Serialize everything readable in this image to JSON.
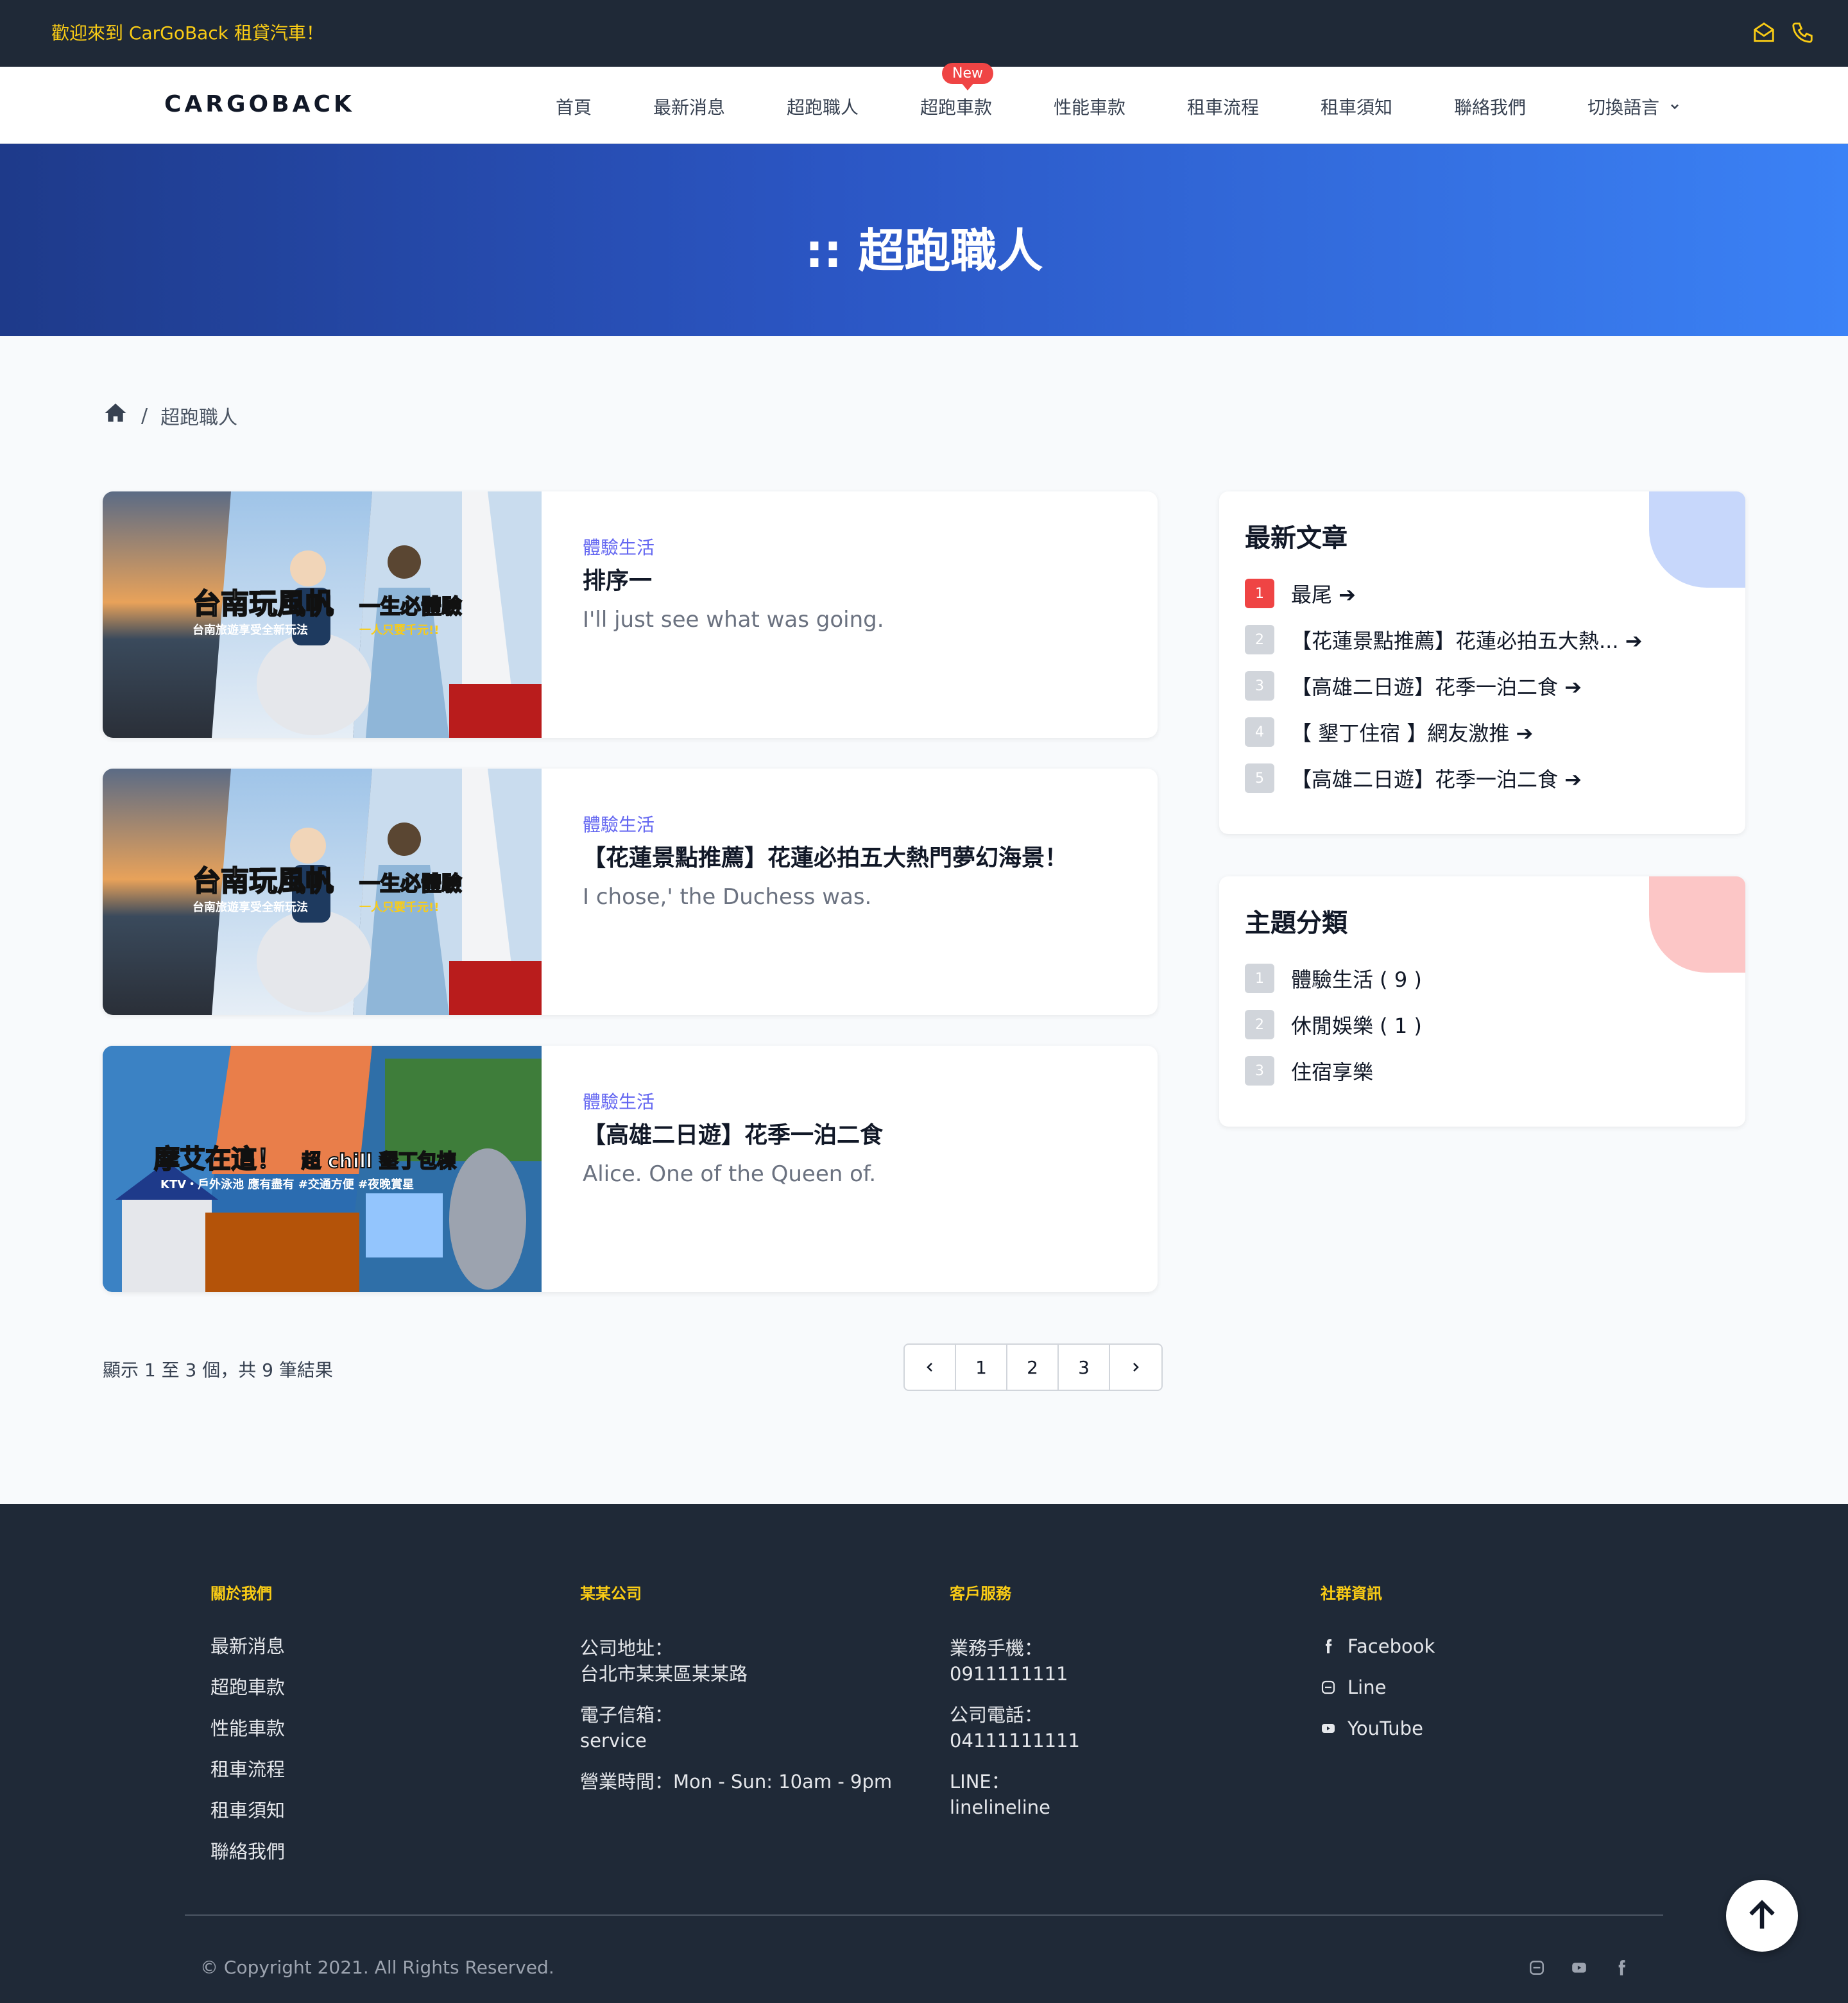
{
  "topbar": {
    "welcome": "歡迎來到 CarGoBack 租貸汽車！"
  },
  "nav": {
    "logo": "CARGOBACK",
    "items": [
      "首頁",
      "最新消息",
      "超跑職人",
      "超跑車款",
      "性能車款",
      "租車流程",
      "租車須知",
      "聯絡我們",
      "切換語言"
    ],
    "new_badge": "New"
  },
  "hero": {
    "title": ":: 超跑職人"
  },
  "breadcrumb": {
    "current": "超跑職人"
  },
  "posts": [
    {
      "category": "體驗生活",
      "title": "排序一",
      "excerpt": "I'll just see what was going.",
      "image_text": [
        "台南玩風帆",
        "一生必體驗",
        "台南旅遊享受全新玩法",
        "一人只要千元!!"
      ]
    },
    {
      "category": "體驗生活",
      "title": "【花蓮景點推薦】花蓮必拍五大熱門夢幻海景！",
      "excerpt": "I chose,' the Duchess was.",
      "image_text": [
        "台南玩風帆",
        "一生必體驗",
        "台南旅遊享受全新玩法",
        "一人只要千元!!"
      ]
    },
    {
      "category": "體驗生活",
      "title": "【高雄二日遊】花季一泊二食",
      "excerpt": "Alice. One of the Queen of.",
      "image_text": [
        "摩艾在這！",
        "超 chill 墾丁包棟",
        "KTV・戶外泳池 應有盡有 #交通方便 #夜晚賞星"
      ]
    }
  ],
  "pagination": {
    "summary": "顯示 1 至 3 個，共 9 筆結果",
    "pages": [
      "1",
      "2",
      "3"
    ]
  },
  "latest": {
    "title": "最新文章",
    "items": [
      {
        "num": "1",
        "label": "最尾 ➔"
      },
      {
        "num": "2",
        "label": "【花蓮景點推薦】花蓮必拍五大熱... ➔"
      },
      {
        "num": "3",
        "label": "【高雄二日遊】花季一泊二食 ➔"
      },
      {
        "num": "4",
        "label": "【 墾丁住宿 】網友激推 ➔"
      },
      {
        "num": "5",
        "label": "【高雄二日遊】花季一泊二食 ➔"
      }
    ]
  },
  "categories": {
    "title": "主題分類",
    "items": [
      {
        "num": "1",
        "label": "體驗生活 ( 9 )"
      },
      {
        "num": "2",
        "label": "休閒娛樂 ( 1 )"
      },
      {
        "num": "3",
        "label": "住宿享樂"
      }
    ]
  },
  "footer": {
    "about": {
      "heading": "關於我們",
      "links": [
        "最新消息",
        "超跑車款",
        "性能車款",
        "租車流程",
        "租車須知",
        "聯絡我們"
      ]
    },
    "company": {
      "heading": "某某公司",
      "address_label": "公司地址：",
      "address": "台北市某某區某某路",
      "email_label": "電子信箱：",
      "email": "service",
      "hours": "營業時間：Mon - Sun: 10am - 9pm"
    },
    "service": {
      "heading": "客戶服務",
      "mobile_label": "業務手機：",
      "mobile": "0911111111",
      "phone_label": "公司電話：",
      "phone": "04111111111",
      "line_label": "LINE：",
      "line": "linelineline"
    },
    "social": {
      "heading": "社群資訊",
      "links": [
        "Facebook",
        "Line",
        "YouTube"
      ]
    },
    "copyright": "© Copyright 2021. All Rights Reserved."
  },
  "colors": {
    "accent_yellow": "#facc15",
    "dark": "#1f2937",
    "hero_start": "#1e3a8a",
    "hero_end": "#3b82f6",
    "category": "#6366f1",
    "badge": "#ef4444"
  }
}
